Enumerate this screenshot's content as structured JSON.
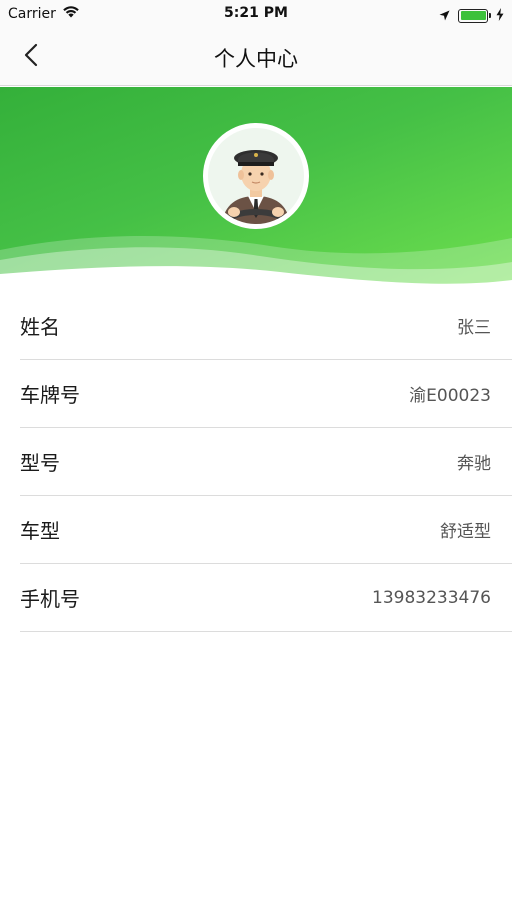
{
  "status_bar": {
    "carrier": "Carrier",
    "time": "5:21 PM"
  },
  "nav": {
    "title": "个人中心",
    "back_icon": "chevron-left-icon"
  },
  "header": {
    "avatar_icon": "driver-avatar-icon",
    "gradient_colors": [
      "#34b03a",
      "#6fe04f"
    ]
  },
  "info": {
    "rows": [
      {
        "label": "姓名",
        "value": "张三"
      },
      {
        "label": "车牌号",
        "value": "渝E00023"
      },
      {
        "label": "型号",
        "value": "奔驰"
      },
      {
        "label": "车型",
        "value": "舒适型"
      },
      {
        "label": "手机号",
        "value": "13983233476"
      }
    ]
  },
  "colors": {
    "accent_green": "#45c046",
    "label_text": "#1a1a1a",
    "value_text": "#555555",
    "divider": "#dcdcdc"
  }
}
